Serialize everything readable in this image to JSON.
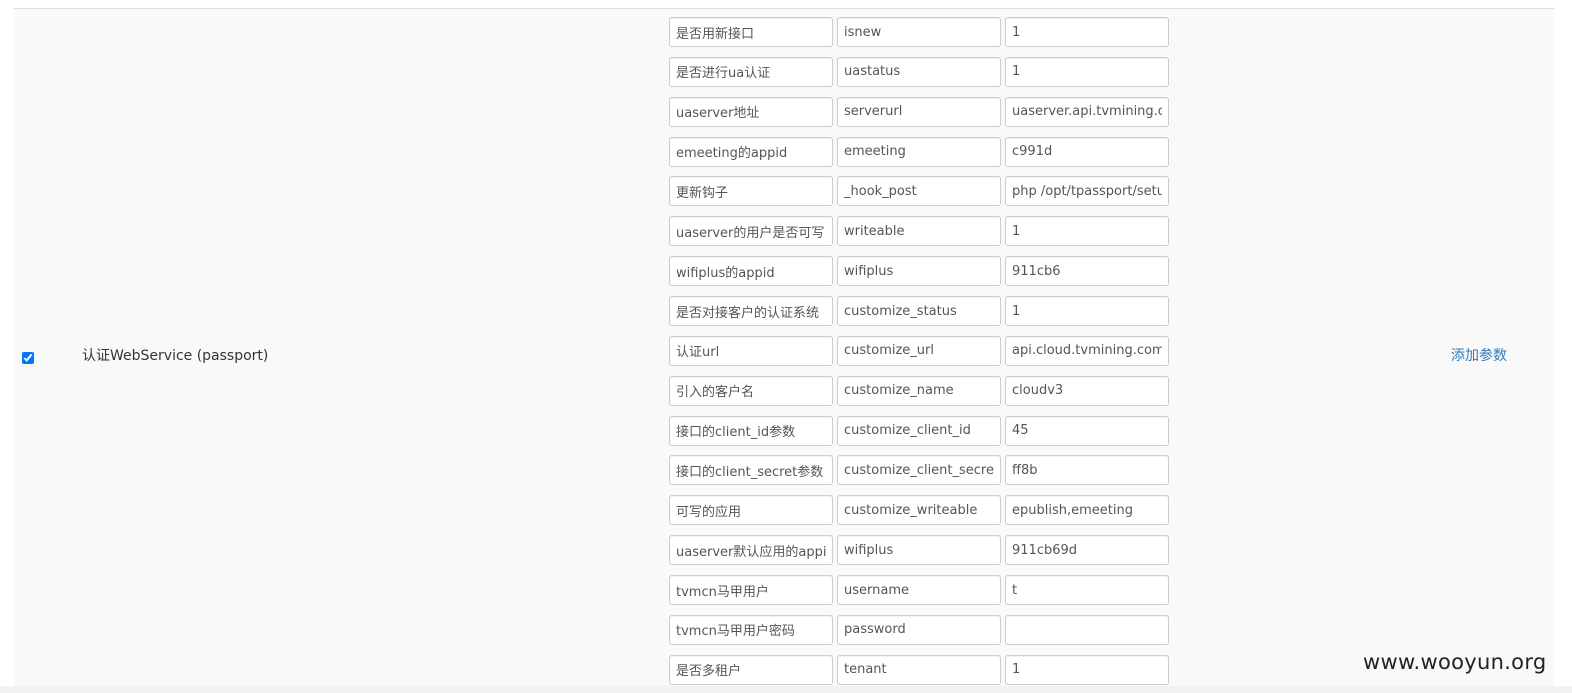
{
  "service": {
    "label": "认证WebService (passport)",
    "checked": true,
    "add_param_label": "添加参数"
  },
  "params": [
    {
      "desc": "是否用新接口",
      "key": "isnew",
      "value": "1"
    },
    {
      "desc": "是否进行ua认证",
      "key": "uastatus",
      "value": "1"
    },
    {
      "desc": "uaserver地址",
      "key": "serverurl",
      "value": "uaserver.api.tvmining.com"
    },
    {
      "desc": "emeeting的appid",
      "key": "emeeting",
      "value": "c991d"
    },
    {
      "desc": "更新钩子",
      "key": "_hook_post",
      "value": "php /opt/tpassport/setup"
    },
    {
      "desc": "uaserver的用户是否可写",
      "key": "writeable",
      "value": "1"
    },
    {
      "desc": "wifiplus的appid",
      "key": "wifiplus",
      "value": "911cb6"
    },
    {
      "desc": "是否对接客户的认证系统",
      "key": "customize_status",
      "value": "1"
    },
    {
      "desc": "认证url",
      "key": "customize_url",
      "value": "api.cloud.tvmining.com"
    },
    {
      "desc": "引入的客户名",
      "key": "customize_name",
      "value": "cloudv3"
    },
    {
      "desc": "接口的client_id参数",
      "key": "customize_client_id",
      "value": "45"
    },
    {
      "desc": "接口的client_secret参数",
      "key": "customize_client_secret",
      "value": "ff8b"
    },
    {
      "desc": "可写的应用",
      "key": "customize_writeable",
      "value": "epublish,emeeting"
    },
    {
      "desc": "uaserver默认应用的appid",
      "key": "wifiplus",
      "value": "911cb69d"
    },
    {
      "desc": "tvmcn马甲用户",
      "key": "username",
      "value": "t"
    },
    {
      "desc": "tvmcn马甲用户密码",
      "key": "password",
      "value": ""
    },
    {
      "desc": "是否多租户",
      "key": "tenant",
      "value": "1"
    }
  ],
  "watermark": "www.wooyun.org"
}
